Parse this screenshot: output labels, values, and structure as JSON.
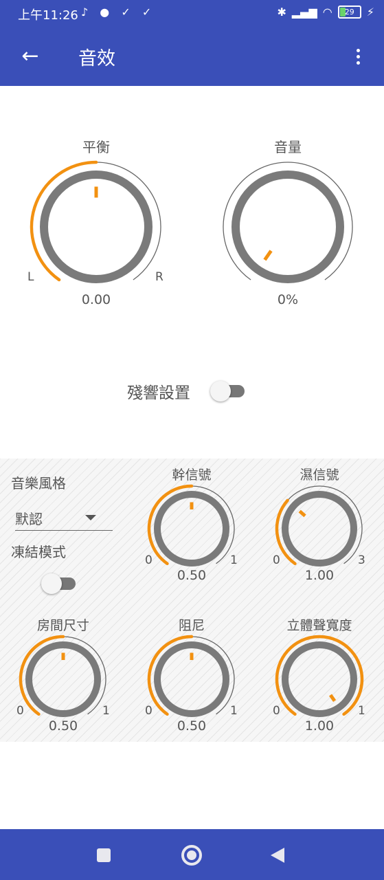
{
  "status": {
    "time": "上午11:26",
    "left_icons": "♪ ● ✓ ✓",
    "bluetooth": "✱",
    "signal": "▂▄▆",
    "wifi": "◠",
    "battery": "29",
    "charging": "⚡"
  },
  "appbar": {
    "title": "音效",
    "back_icon": "←"
  },
  "balance": {
    "label": "平衡",
    "value": "0.00",
    "min": "L",
    "max": "R",
    "level": 0.5
  },
  "volume": {
    "label": "音量",
    "value": "0%",
    "level": 0.0
  },
  "reverb": {
    "label": "殘響設置",
    "enabled": false
  },
  "panel": {
    "style_label": "音樂風格",
    "style_value": "默認",
    "freeze_label": "凍結模式",
    "knobs": [
      {
        "key": "dry",
        "label": "幹信號",
        "value": "0.50",
        "min": "0",
        "max": "1",
        "level": 0.5
      },
      {
        "key": "wet",
        "label": "濕信號",
        "value": "1.00",
        "min": "0",
        "max": "3",
        "level": 0.333
      },
      {
        "key": "room",
        "label": "房間尺寸",
        "value": "0.50",
        "min": "0",
        "max": "1",
        "level": 0.5
      },
      {
        "key": "damping",
        "label": "阻尼",
        "value": "0.50",
        "min": "0",
        "max": "1",
        "level": 0.5
      },
      {
        "key": "width",
        "label": "立體聲寬度",
        "value": "1.00",
        "min": "0",
        "max": "1",
        "level": 1.0
      }
    ]
  },
  "colors": {
    "accent": "#f29111",
    "bar": "#3a4fb8",
    "ring": "#7a7a7a"
  }
}
